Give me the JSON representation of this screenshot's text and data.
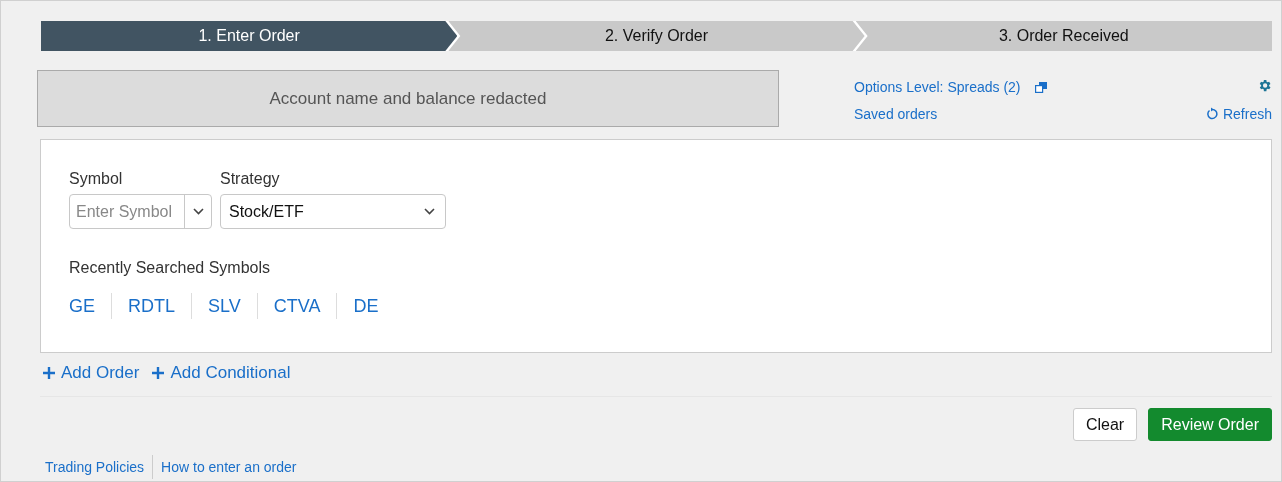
{
  "steps": [
    {
      "label": "1. Enter Order",
      "selected": true
    },
    {
      "label": "2. Verify Order",
      "selected": false
    },
    {
      "label": "3. Order Received",
      "selected": false
    }
  ],
  "account": {
    "text": "Account name and balance redacted"
  },
  "links": {
    "options_level": "Options Level: Spreads (2)",
    "saved_orders": "Saved orders",
    "refresh": "Refresh"
  },
  "order_form": {
    "symbol_label": "Symbol",
    "symbol_placeholder": "Enter Symbol",
    "strategy_label": "Strategy",
    "strategy_value": "Stock/ETF",
    "recent_label": "Recently Searched Symbols",
    "recent_symbols": [
      "GE",
      "RDTL",
      "SLV",
      "CTVA",
      "DE"
    ]
  },
  "add_actions": [
    "Add Order",
    "Add Conditional"
  ],
  "buttons": {
    "clear": "Clear",
    "review": "Review Order"
  },
  "footer_links": [
    "Trading Policies",
    "How to enter an order"
  ]
}
